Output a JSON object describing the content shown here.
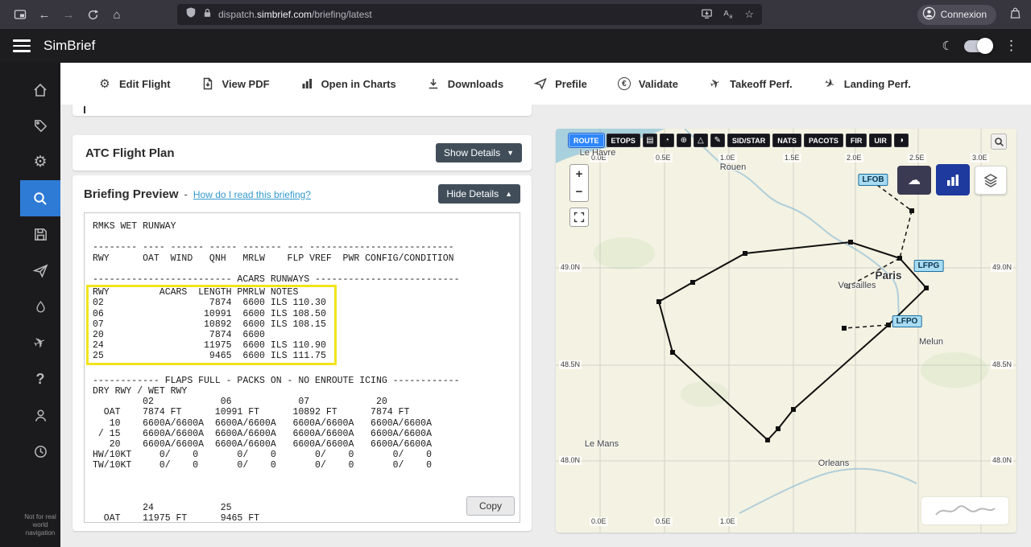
{
  "colors": {
    "accent_blue": "#2e86ff",
    "sidebar_active": "#2e7bd6",
    "highlight_yellow": "#f2e41c",
    "link": "#3399cc",
    "map_land": "#f4f2e2"
  },
  "icons": {
    "back": "←",
    "forward": "→",
    "home": "⌂",
    "star": "☆",
    "gear": "⚙",
    "plane": "✈",
    "euro": "€",
    "moon": "☾",
    "dots": "⋮",
    "cloud": "☁",
    "question": "?",
    "pages": "▤",
    "clock": "◔",
    "globe": "⊕",
    "warning": "△",
    "pencil": "✎",
    "halfmoon": "◑",
    "caret_down": "▼",
    "caret_up": "▲",
    "zoom_in": "+",
    "zoom_out": "−"
  },
  "browser": {
    "url_prefix": "dispatch.",
    "url_domain": "simbrief.com",
    "url_path": "/briefing/latest",
    "connexion_label": "Connexion"
  },
  "header": {
    "app_title": "SimBrief"
  },
  "toolbar": {
    "items": [
      {
        "label": "Edit Flight"
      },
      {
        "label": "View PDF"
      },
      {
        "label": "Open in Charts"
      },
      {
        "label": "Downloads"
      },
      {
        "label": "Prefile"
      },
      {
        "label": "Validate"
      },
      {
        "label": "Takeoff Perf."
      },
      {
        "label": "Landing Perf."
      }
    ]
  },
  "sidebar": {
    "disclaimer": "Not for real world navigation"
  },
  "atc_card": {
    "title": "ATC Flight Plan",
    "details_button": "Show Details"
  },
  "briefing_card": {
    "title": "Briefing Preview",
    "separator": "-",
    "help_link": "How do I read this briefing?",
    "details_button": "Hide Details",
    "copy_button": "Copy",
    "text_before": [
      "RMKS WET RUNWAY",
      "",
      "-------- ---- ------ ----- ------- --- --------------------------",
      "RWY      OAT  WIND   QNH   MRLW    FLP VREF  PWR CONFIG/CONDITION",
      "",
      "------------------------- ACARS RUNWAYS --------------------------",
      ""
    ],
    "text_highlight": [
      "RWY         ACARS  LENGTH PMRLW NOTES",
      "02                   7874  6600 ILS 110.30",
      "06                  10991  6600 ILS 108.50",
      "07                  10892  6600 ILS 108.15",
      "20                   7874  6600",
      "24                  11975  6600 ILS 110.90",
      "25                   9465  6600 ILS 111.75"
    ],
    "text_after": [
      "",
      "",
      "------------ FLAPS FULL - PACKS ON - NO ENROUTE ICING ------------",
      "DRY RWY / WET RWY",
      "         02            06            07            20",
      "  OAT    7874 FT      10991 FT      10892 FT      7874 FT",
      "   10    6600A/6600A  6600A/6600A   6600A/6600A   6600A/6600A",
      " / 15    6600A/6600A  6600A/6600A   6600A/6600A   6600A/6600A",
      "   20    6600A/6600A  6600A/6600A   6600A/6600A   6600A/6600A",
      "HW/10KT     0/    0       0/    0       0/    0       0/    0",
      "TW/10KT     0/    0       0/    0       0/    0       0/    0",
      "",
      "",
      "",
      "         24            25",
      "  OAT    11975 FT      9465 FT"
    ]
  },
  "map": {
    "buttons": {
      "route": "ROUTE",
      "etops": "ETOPS",
      "sidstar": "SID/STAR",
      "nats": "NATS",
      "pacots": "PACOTS",
      "fir": "FIR",
      "uir": "UIR"
    },
    "grid": {
      "lon": [
        "0.0E",
        "0.5E",
        "1.0E",
        "1.5E",
        "2.0E",
        "2.5E",
        "3.0E"
      ],
      "lon_bottom": [
        "0.0E",
        "0.5E",
        "1.0E"
      ],
      "lat": [
        "49.0N",
        "48.5N",
        "48.0N"
      ]
    },
    "cities": {
      "le_havre": "Le Havre",
      "rouen": "Rouen",
      "paris": "Paris",
      "versailles": "Versailles",
      "melun": "Melun",
      "le_mans": "Le Mans",
      "orleans": "Orleans"
    },
    "airports": {
      "lfob": "LFOB",
      "lfpg": "LFPG",
      "lfpo": "LFPO"
    }
  }
}
